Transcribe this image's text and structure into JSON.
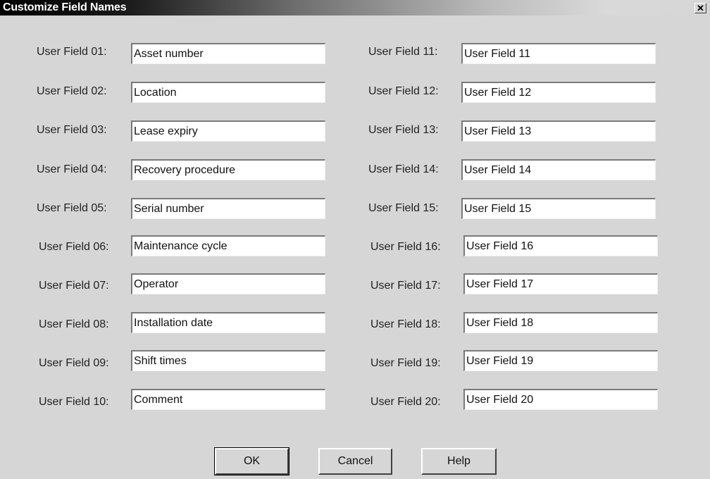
{
  "window": {
    "title": "Customize Field Names",
    "close_icon": "close-icon"
  },
  "left_fields": [
    {
      "label": "User Field 01:",
      "value": "Asset number"
    },
    {
      "label": "User Field 02:",
      "value": "Location"
    },
    {
      "label": "User Field 03:",
      "value": "Lease expiry"
    },
    {
      "label": "User Field 04:",
      "value": "Recovery procedure"
    },
    {
      "label": "User Field 05:",
      "value": "Serial number"
    },
    {
      "label": "User Field 06:",
      "value": "Maintenance cycle"
    },
    {
      "label": "User Field 07:",
      "value": "Operator"
    },
    {
      "label": "User Field 08:",
      "value": "Installation date"
    },
    {
      "label": "User Field 09:",
      "value": "Shift times"
    },
    {
      "label": "User Field 10:",
      "value": "Comment"
    }
  ],
  "right_fields": [
    {
      "label": "User Field 11:",
      "value": "User Field 11"
    },
    {
      "label": "User Field 12:",
      "value": "User Field 12"
    },
    {
      "label": "User Field 13:",
      "value": "User Field 13"
    },
    {
      "label": "User Field 14:",
      "value": "User Field 14"
    },
    {
      "label": "User Field 15:",
      "value": "User Field 15"
    },
    {
      "label": "User Field 16:",
      "value": "User Field 16"
    },
    {
      "label": "User Field 17:",
      "value": "User Field 17"
    },
    {
      "label": "User Field 18:",
      "value": "User Field 18"
    },
    {
      "label": "User Field 19:",
      "value": "User Field 19"
    },
    {
      "label": "User Field 20:",
      "value": "User Field 20"
    }
  ],
  "buttons": {
    "ok": "OK",
    "cancel": "Cancel",
    "help": "Help"
  }
}
